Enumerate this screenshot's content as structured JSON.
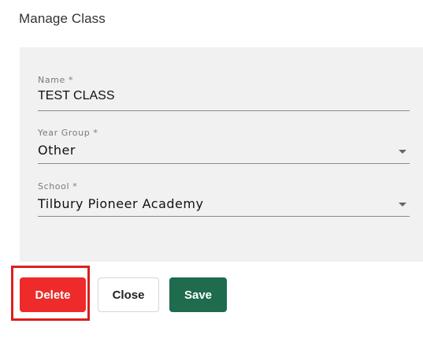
{
  "dialog": {
    "title": "Manage Class"
  },
  "form": {
    "name": {
      "label": "Name *",
      "value": "TEST CLASS"
    },
    "year_group": {
      "label": "Year Group *",
      "value": "Other"
    },
    "school": {
      "label": "School *",
      "value": "Tilbury Pioneer Academy"
    }
  },
  "actions": {
    "delete_label": "Delete",
    "close_label": "Close",
    "save_label": "Save"
  },
  "colors": {
    "delete": "#ee2a2a",
    "save": "#1e6b4e",
    "highlight": "#d92020",
    "panel": "#f1f1f1"
  },
  "icons": {
    "select_arrow": "chevron-down-icon"
  }
}
